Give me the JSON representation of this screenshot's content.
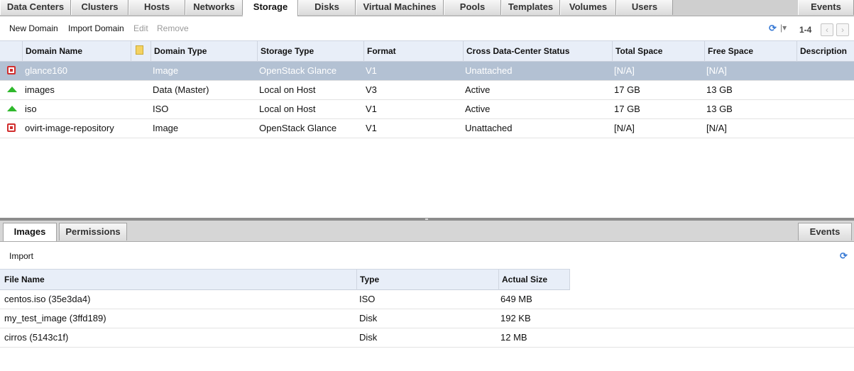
{
  "top_tabs": [
    {
      "label": "Data Centers",
      "active": false
    },
    {
      "label": "Clusters",
      "active": false
    },
    {
      "label": "Hosts",
      "active": false
    },
    {
      "label": "Networks",
      "active": false
    },
    {
      "label": "Storage",
      "active": true
    },
    {
      "label": "Disks",
      "active": false
    },
    {
      "label": "Virtual Machines",
      "active": false
    },
    {
      "label": "Pools",
      "active": false
    },
    {
      "label": "Templates",
      "active": false
    },
    {
      "label": "Volumes",
      "active": false
    },
    {
      "label": "Users",
      "active": false
    }
  ],
  "events_tab": "Events",
  "toolbar": {
    "new_domain": "New Domain",
    "import_domain": "Import Domain",
    "edit": "Edit",
    "remove": "Remove",
    "refresh_icon": "refresh-icon",
    "pager": "1-4",
    "prev": "‹",
    "next": "›"
  },
  "domains": {
    "columns": [
      "Domain Name",
      "",
      "Domain Type",
      "Storage Type",
      "Format",
      "Cross Data-Center Status",
      "Total Space",
      "Free Space",
      "Description"
    ],
    "rows": [
      {
        "status": "down",
        "name": "glance160",
        "type": "Image",
        "storage_type": "OpenStack Glance",
        "format": "V1",
        "dc_status": "Unattached",
        "total": "[N/A]",
        "free": "[N/A]",
        "description": "",
        "selected": true
      },
      {
        "status": "up",
        "name": "images",
        "type": "Data (Master)",
        "storage_type": "Local on Host",
        "format": "V3",
        "dc_status": "Active",
        "total": "17 GB",
        "free": "13 GB",
        "description": "",
        "selected": false
      },
      {
        "status": "up",
        "name": "iso",
        "type": "ISO",
        "storage_type": "Local on Host",
        "format": "V1",
        "dc_status": "Active",
        "total": "17 GB",
        "free": "13 GB",
        "description": "",
        "selected": false
      },
      {
        "status": "down",
        "name": "ovirt-image-repository",
        "type": "Image",
        "storage_type": "OpenStack Glance",
        "format": "V1",
        "dc_status": "Unattached",
        "total": "[N/A]",
        "free": "[N/A]",
        "description": "",
        "selected": false
      }
    ]
  },
  "sub_tabs": [
    {
      "label": "Images",
      "active": true
    },
    {
      "label": "Permissions",
      "active": false
    }
  ],
  "sub_events_tab": "Events",
  "images": {
    "import": "Import",
    "columns": [
      "File Name",
      "Type",
      "Actual Size"
    ],
    "rows": [
      {
        "file": "centos.iso (35e3da4)",
        "type": "ISO",
        "size": "649 MB"
      },
      {
        "file": "my_test_image (3ffd189)",
        "type": "Disk",
        "size": "192 KB"
      },
      {
        "file": "cirros (5143c1f)",
        "type": "Disk",
        "size": "12 MB"
      }
    ]
  },
  "colors": {
    "selected_row": "#b3c1d3",
    "header_bg": "#e8eef8",
    "status_up": "#2fb82c",
    "status_down": "#d12e2e"
  }
}
